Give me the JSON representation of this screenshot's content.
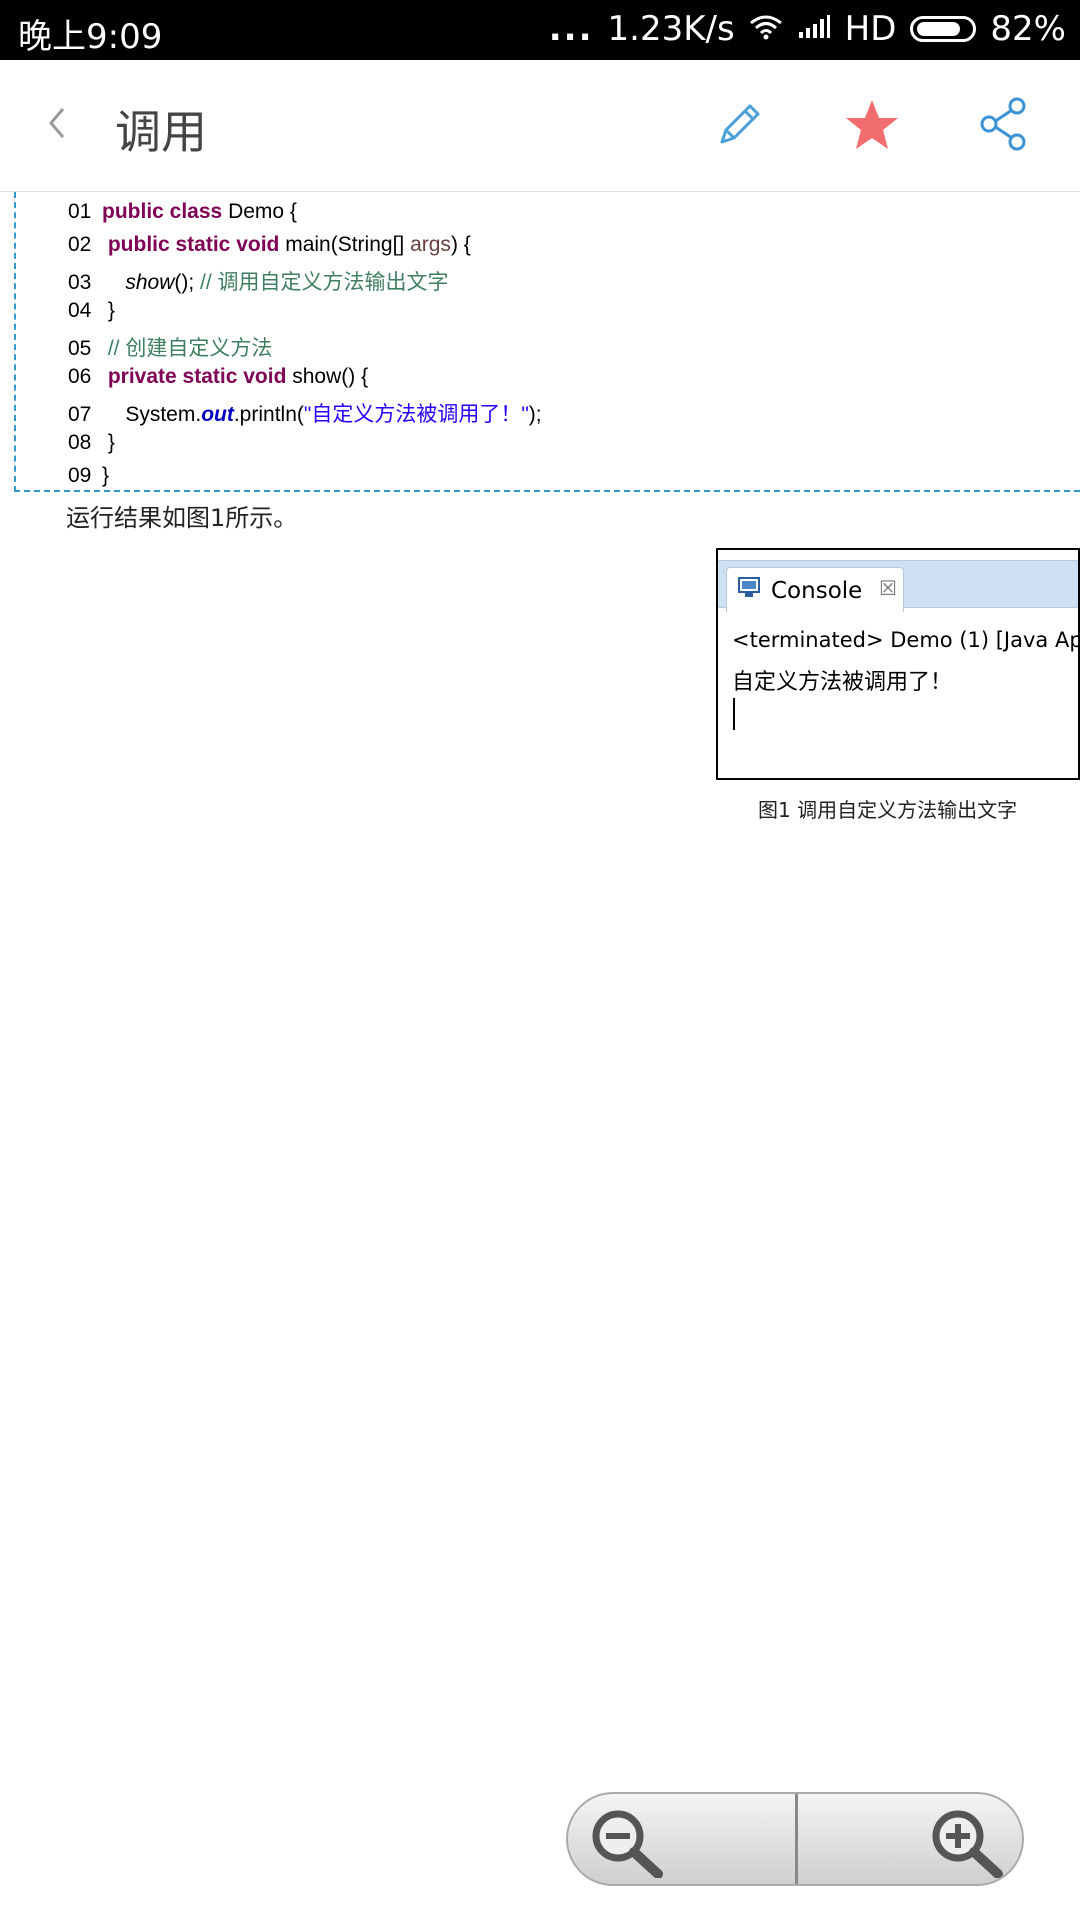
{
  "status_bar": {
    "time": "晚上9:09",
    "signal_dots": "...",
    "network_speed": "1.23K/s",
    "network_type": "HD",
    "battery_percent": "82%",
    "battery_level": 0.82,
    "icons": [
      "wifi-icon",
      "signal-bars-icon",
      "battery-icon"
    ]
  },
  "toolbar": {
    "back_icon": "chevron-left-icon",
    "title": "调用",
    "edit_icon": "pencil-icon",
    "favorite_icon": "star-icon",
    "share_icon": "share-icon",
    "colors": {
      "pencil": "#4a9fd8",
      "star": "#f26d6d",
      "share": "#3b92d6"
    }
  },
  "code": {
    "lines": [
      {
        "num": "01",
        "parts": [
          {
            "t": "public class ",
            "c": "kw"
          },
          {
            "t": "Demo {",
            "c": ""
          }
        ]
      },
      {
        "num": "02",
        "parts": [
          {
            "t": " public static void ",
            "c": "kw"
          },
          {
            "t": "main(String[] ",
            "c": ""
          },
          {
            "t": "args",
            "c": "param"
          },
          {
            "t": ") {",
            "c": ""
          }
        ]
      },
      {
        "num": "03",
        "parts": [
          {
            "t": "    ",
            "c": ""
          },
          {
            "t": "show",
            "c": "it"
          },
          {
            "t": "(); ",
            "c": ""
          },
          {
            "t": "// 调用自定义方法输出文字",
            "c": "cm"
          }
        ]
      },
      {
        "num": "04",
        "parts": [
          {
            "t": " }",
            "c": ""
          }
        ]
      },
      {
        "num": "05",
        "parts": [
          {
            "t": " ",
            "c": ""
          },
          {
            "t": "// 创建自定义方法",
            "c": "cm"
          }
        ]
      },
      {
        "num": "06",
        "parts": [
          {
            "t": " private static void ",
            "c": "kw"
          },
          {
            "t": "show() {",
            "c": ""
          }
        ]
      },
      {
        "num": "07",
        "parts": [
          {
            "t": "    System.",
            "c": ""
          },
          {
            "t": "out",
            "c": "fld"
          },
          {
            "t": ".println(",
            "c": ""
          },
          {
            "t": "\"自定义方法被调用了！\"",
            "c": "st"
          },
          {
            "t": ");",
            "c": ""
          }
        ]
      },
      {
        "num": "08",
        "parts": [
          {
            "t": " }",
            "c": ""
          }
        ]
      },
      {
        "num": "09",
        "parts": [
          {
            "t": "}",
            "c": ""
          }
        ]
      }
    ]
  },
  "paragraph": "运行结果如图1所示。",
  "figure": {
    "tab_label": "Console",
    "tab_close": "☒",
    "terminated_line": "<terminated> Demo (1) [Java Ap",
    "output": "自定义方法被调用了！",
    "caption": "图1  调用自定义方法输出文字"
  },
  "zoom_controls": {
    "zoom_out_icon": "zoom-out-icon",
    "zoom_in_icon": "zoom-in-icon"
  }
}
